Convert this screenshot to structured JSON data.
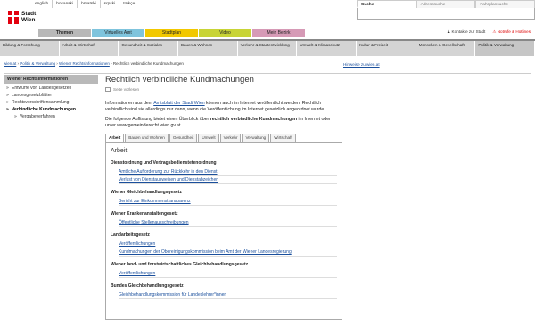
{
  "languages": [
    "english",
    "bosanski",
    "hrvatski",
    "srpski",
    "türkçe"
  ],
  "logo": {
    "line1": "Stadt",
    "line2": "Wien"
  },
  "search": {
    "tabs": [
      "Suche",
      "Adresssuche",
      "Fahrplansuche"
    ],
    "value": ""
  },
  "category_tabs": [
    {
      "label": "Themen",
      "color": "#b8b8b8"
    },
    {
      "label": "Virtuelles Amt",
      "color": "#7fc4dd"
    },
    {
      "label": "Stadtplan",
      "color": "#f2c800"
    },
    {
      "label": "Video",
      "color": "#c8d436"
    },
    {
      "label": "Mein Bezirk",
      "color": "#d69ab6"
    }
  ],
  "top_links": {
    "contact": "Kontakte zur Stadt",
    "emergency": "Notrufe & Hotlines"
  },
  "nav": [
    "Bildung & Forschung",
    "Arbeit & Wirtschaft",
    "Gesundheit & Soziales",
    "Bauen & Wohnen",
    "Verkehr & Stadtentwicklung",
    "Umwelt & Klimaschutz",
    "Kultur & Freizeit",
    "Menschen & Gesellschaft",
    "Politik & Verwaltung"
  ],
  "breadcrumb": [
    "wien.at",
    "Politik & Verwaltung",
    "Wiener Rechtsinformationen",
    "Rechtlich verbindliche Kundmachungen"
  ],
  "hint_link": "Hinweise zu wien.at",
  "sidebar": {
    "heading": "Wiener Rechtsinformationen",
    "items": [
      "Entwürfe von Landesgesetzen",
      "Landesgesetzblätter",
      "Rechtsvorschriftensammlung",
      "Verbindliche Kundmachungen",
      "Vergabeverfahren"
    ]
  },
  "main": {
    "title": "Rechtlich verbindliche Kundmachungen",
    "read_aloud": "Seite vorlesen",
    "p1_a": "Informationen aus dem ",
    "p1_link": "Amtsblatt der Stadt Wien",
    "p1_b": " können auch im Internet veröffentlicht werden. Rechtlich verbindlich sind sie allerdings nur dann, wenn die Veröffentlichung im Internet gesetzlich angeordnet wurde.",
    "p2_a": "Die folgende Auflistung bietet einen Überblick über ",
    "p2_bold": "rechtlich verbindliche Kundmachungen",
    "p2_b": " im Internet oder unter www.gemeinderecht.wien.gv.at.",
    "tabs": [
      "Arbeit",
      "Bauen und Wohnen",
      "Gesundheit",
      "Umwelt",
      "Verkehr",
      "Verwaltung",
      "Wirtschaft"
    ],
    "panel_title": "Arbeit",
    "sections": [
      {
        "title": "Dienstordnung und Vertragsbedienstetenordnung",
        "links": [
          "Amtliche Aufforderung zur Rückkehr in den Dienst",
          "Verlust von Dienstausweisen und Dienstabzeichen"
        ]
      },
      {
        "title": "Wiener Gleichbehandlungsgesetz",
        "links": [
          "Bericht zur Einkommenstransparenz"
        ]
      },
      {
        "title": "Wiener Krankenanstaltengesetz",
        "links": [
          "Öffentliche Stellenausschreibungen"
        ]
      },
      {
        "title": "Landarbeitsgesetz",
        "links": [
          "Veröffentlichungen",
          "Kundmachungen der Obereinigungskommission beim Amt der Wiener Landesregierung"
        ]
      },
      {
        "title": "Wiener land- und forstwirtschaftliches Gleichbehandlungsgesetz",
        "links": [
          "Veröffentlichungen"
        ]
      },
      {
        "title": "Bundes Gleichbehandlungsgesetz",
        "links": [
          "Gleichbehandlungskommission für Landeslehrer*innen"
        ]
      }
    ]
  }
}
